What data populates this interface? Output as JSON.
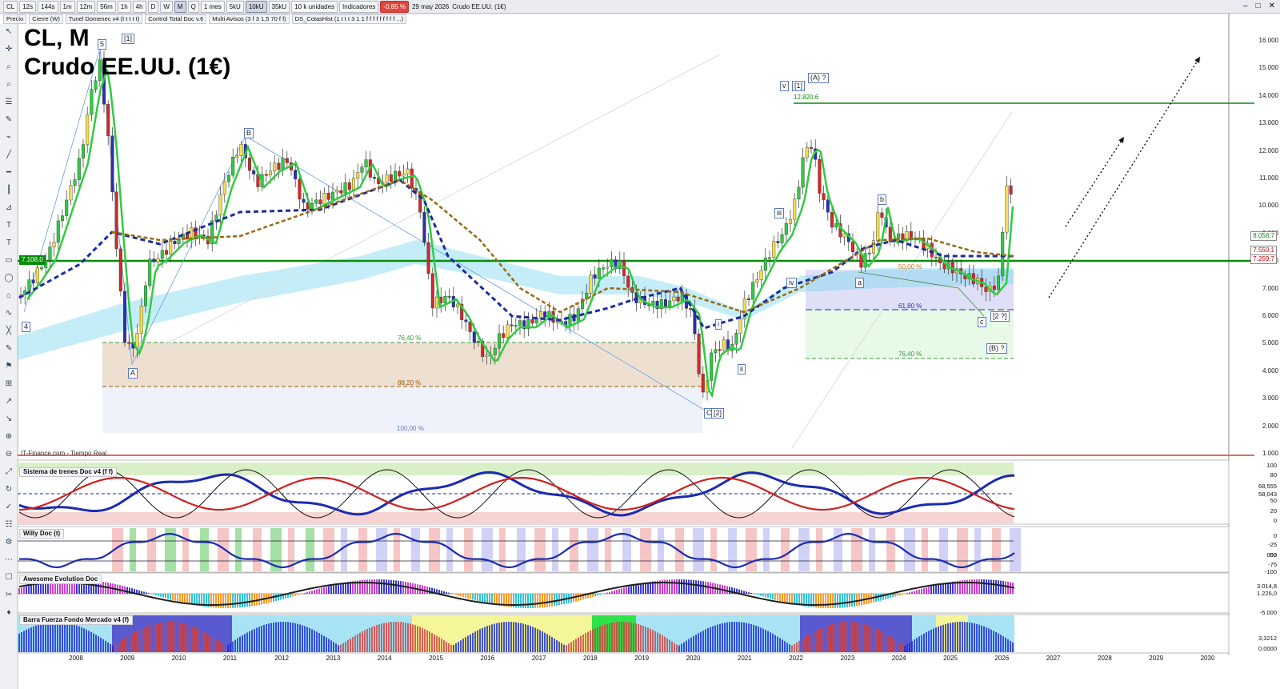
{
  "toolbar": {
    "symbol": "CL",
    "intervals": [
      "12s",
      "144s",
      "1m",
      "12m",
      "56m",
      "1h",
      "4h",
      "D",
      "W",
      "M",
      "Q"
    ],
    "active_interval": "M",
    "range": "1 mes",
    "volumes": [
      "5kU",
      "10kU",
      "35kU"
    ],
    "active_volume": "10kU",
    "units": "10 k unidades",
    "indicators_label": "Indicadores",
    "change": "-0,85 %",
    "date": "29 may 2026",
    "instrument": "Crudo EE.UU. (1€)"
  },
  "indicator_bar": [
    "Precio",
    "Cierre (W)",
    "Tunel Domenec v4 (t t t t t)",
    "Control Total Doc v.6",
    "Multi Avisos (3 f 3 1,5 70 f f)",
    "DS_CotasHist (1 t t t 3 1 1 f f f f f f f f f ...)"
  ],
  "chart": {
    "title": "CL, M",
    "subtitle": "Crudo EE.UU. (1€)",
    "source": "IT-Finance.com - Tiempo Real"
  },
  "price_axis": [
    "16.000",
    "15.000",
    "14.000",
    "13.000",
    "12.000",
    "11.000",
    "10.000",
    "9.000",
    "8.000",
    "7.000",
    "6.000",
    "5.000",
    "4.000",
    "3.000",
    "2.000",
    "1.000"
  ],
  "price_tags": {
    "last": "8.058,7",
    "ma1": "7.550,1",
    "ma2": "7.259,7",
    "support": "7.108,0",
    "resistance": "12.820,6"
  },
  "fibonacci": {
    "left": [
      "76,40 %",
      "88,20 %",
      "100,00 %"
    ],
    "right": [
      "50,00 %",
      "61,80 %",
      "76,40 %"
    ]
  },
  "waves": {
    "w5": "5",
    "w1a": "[1]",
    "w4": "4",
    "wA": "A",
    "wB": "B",
    "wC": "C",
    "w2": "[2]",
    "v": "v",
    "v1": "[1]",
    "A_q": "(A) ?",
    "iii": "iii",
    "iv": "iv",
    "i": "i",
    "ii": "ii",
    "a": "a",
    "b": "b",
    "c": "c",
    "two_q": "[2 ?]",
    "B_q": "(B) ?"
  },
  "panels": [
    {
      "name": "Sistema de trenes Doc v4 (f f)",
      "axis": [
        "100",
        "80",
        "68,555",
        "58,043",
        "50",
        "20",
        "0"
      ]
    },
    {
      "name": "Willy Doc (t)",
      "axis": [
        "0",
        "-25",
        "-50",
        "-75",
        "-100",
        "003"
      ]
    },
    {
      "name": "Awesome Evolution Doc",
      "axis": [
        "3.014,8",
        "1.226,0",
        "-5.000"
      ]
    },
    {
      "name": "Barra Fuerza Fondo Mercado v4 (f)",
      "axis": [
        "3,3212",
        "0,0000"
      ]
    }
  ],
  "years": [
    "2008",
    "2009",
    "2010",
    "2011",
    "2012",
    "2013",
    "2014",
    "2015",
    "2016",
    "2017",
    "2018",
    "2019",
    "2020",
    "2021",
    "2022",
    "2023",
    "2024",
    "2025",
    "2026",
    "2027",
    "2028",
    "2029",
    "2030"
  ],
  "colors": {
    "bull": "#2ecc40",
    "bear": "#d62728",
    "support_line": "#0a8a0a",
    "channel": "#7ed6ef",
    "ma_dashed": "#1a2ba0",
    "ma_brown": "#9a6a12"
  }
}
